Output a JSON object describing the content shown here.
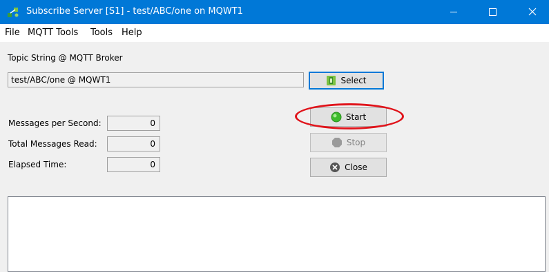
{
  "window": {
    "title": "Subscribe Server [S1] - test/ABC/one on MQWT1",
    "min_glyph": "—",
    "max_glyph": "☐",
    "close_glyph": "✕"
  },
  "menu": [
    "File",
    "MQTT Tools",
    "Tools",
    "Help"
  ],
  "topic": {
    "label": "Topic String @ MQTT Broker",
    "value": "test/ABC/one @ MQWT1",
    "select_label": "Select"
  },
  "stats": [
    {
      "label": "Messages per Second:",
      "value": "0"
    },
    {
      "label": "Total Messages Read:",
      "value": "0"
    },
    {
      "label": "Elapsed Time:",
      "value": "0"
    }
  ],
  "buttons": {
    "start": "Start",
    "stop": "Stop",
    "close": "Close"
  },
  "colors": {
    "titlebar": "#0078d7",
    "highlight": "#e0131a",
    "start_icon": "#3dbb2c"
  }
}
